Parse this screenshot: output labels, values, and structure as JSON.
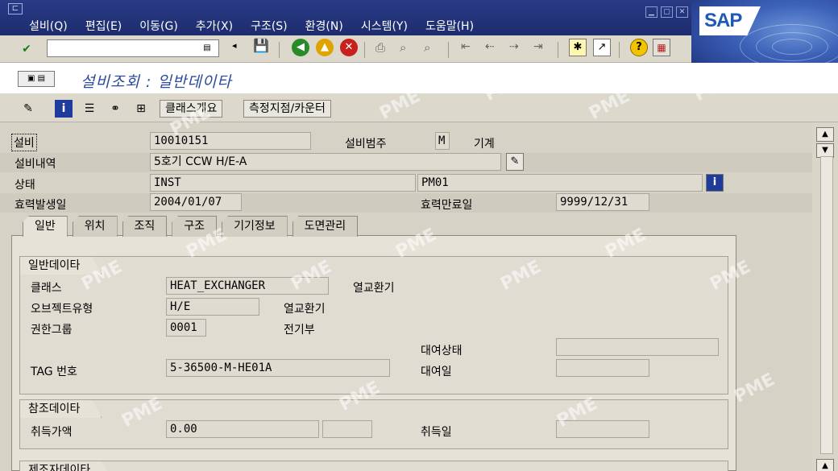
{
  "menu": [
    "설비(Q)",
    "편집(E)",
    "이동(G)",
    "추가(X)",
    "구조(S)",
    "환경(N)",
    "시스템(Y)",
    "도움말(H)"
  ],
  "logo": "SAP",
  "title": "설비조회 : 일반데이타",
  "app_toolbar": {
    "class_overview": "클래스개요",
    "measuring_point": "측정지점/카운터"
  },
  "header": {
    "equipment_label": "설비",
    "equipment_value": "10010151",
    "category_label": "설비범주",
    "category_code": "M",
    "category_text": "기계",
    "desc_label": "설비내역",
    "desc_value": "5호기 CCW H/E-A",
    "status_label": "상태",
    "status_value": "INST",
    "status2_value": "PM01",
    "valid_from_label": "효력발생일",
    "valid_from_value": "2004/01/07",
    "valid_to_label": "효력만료일",
    "valid_to_value": "9999/12/31"
  },
  "tabs": [
    "일반",
    "위치",
    "조직",
    "구조",
    "기기정보",
    "도면관리"
  ],
  "general": {
    "title": "일반데이타",
    "class_label": "클래스",
    "class_value": "HEAT_EXCHANGER",
    "class_text": "열교환기",
    "objtype_label": "오브젝트유형",
    "objtype_value": "H/E",
    "objtype_text": "열교환기",
    "authgroup_label": "권한그룹",
    "authgroup_value": "0001",
    "authgroup_text": "전기부",
    "rental_status_label": "대여상태",
    "tag_label": "TAG 번호",
    "tag_value": "5-36500-M-HE01A",
    "rental_date_label": "대여일"
  },
  "reference": {
    "title": "참조데이타",
    "acq_value_label": "취득가액",
    "acq_value": "0.00",
    "acq_date_label": "취득일"
  },
  "manufacturer": {
    "title": "제조자데이타"
  },
  "watermark": "PME"
}
